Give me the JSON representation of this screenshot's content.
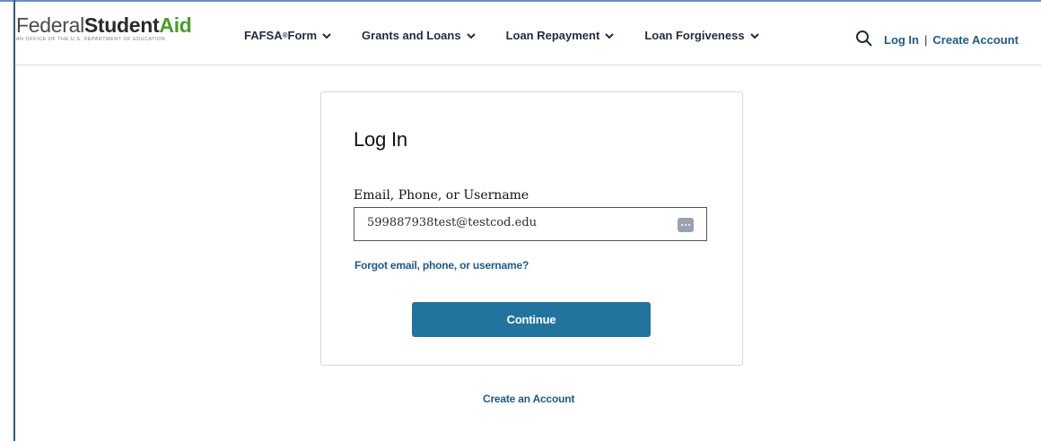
{
  "header": {
    "logo": {
      "word1": "Federal",
      "word2": "Student",
      "word3": "Aid",
      "tagline": "An OFFICE of the U.S. DEPARTMENT of EDUCATION"
    },
    "nav": [
      {
        "label": "FAFSA",
        "suffix": " Form",
        "sup": "®"
      },
      {
        "label": "Grants and Loans"
      },
      {
        "label": "Loan Repayment"
      },
      {
        "label": "Loan Forgiveness"
      }
    ],
    "search_icon": "search-icon",
    "login_label": "Log In",
    "separator": "|",
    "create_account_label": "Create Account"
  },
  "login": {
    "title": "Log In",
    "field_label": "Email, Phone, or Username",
    "field_value": "599887938test@testcod.edu",
    "password_manager_icon": "more-dots-icon",
    "forgot_link": "Forgot email, phone, or username?",
    "continue_label": "Continue"
  },
  "footer": {
    "create_account_link": "Create an Account"
  },
  "colors": {
    "accent": "#23739f",
    "link": "#1f5a8a",
    "logo_green": "#4c9b2e"
  }
}
